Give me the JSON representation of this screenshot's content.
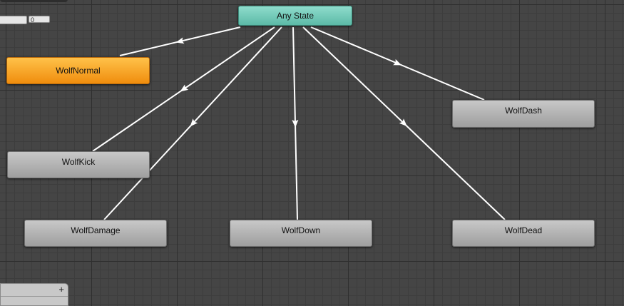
{
  "states": {
    "any_state": "Any State",
    "wolf_normal": "WolfNormal",
    "wolf_dash": "WolfDash",
    "wolf_kick": "WolfKick",
    "wolf_damage": "WolfDamage",
    "wolf_down": "WolfDown",
    "wolf_dead": "WolfDead"
  },
  "parameters_panel": {
    "add_icon": "+",
    "field_value": "0"
  },
  "colors": {
    "any_state": "#6ccbb8",
    "default_state": "#f7a421",
    "state": "#b4b4b4",
    "transition": "#ffffff",
    "grid_background": "#454545"
  },
  "icons": {
    "add": "plus-icon",
    "arrow": "arrow-head-icon"
  }
}
